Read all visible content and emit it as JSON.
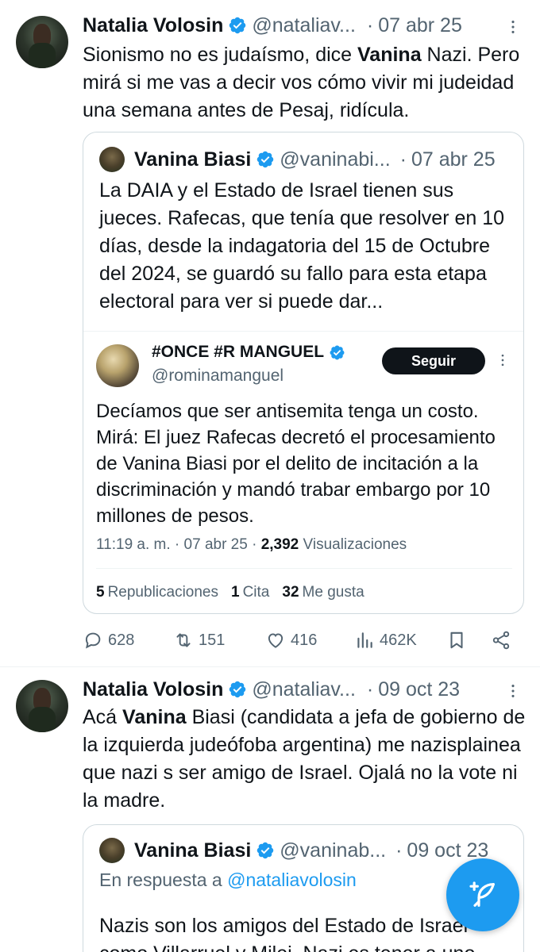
{
  "tweet1": {
    "name": "Natalia Volosin",
    "handle": "@nataliav...",
    "date": "07 abr 25",
    "text_a": "Sionismo no es judaísmo, dice ",
    "text_bold": "Vanina",
    "text_b": " Nazi. Pero mirá si me vas a decir vos cómo vivir mi judeidad una semana antes de Pesaj, ridícula.",
    "quote": {
      "name": "Vanina Biasi",
      "handle": "@vaninabi...",
      "date": "07 abr 25",
      "text": "La DAIA y el Estado de Israel tienen sus jueces. Rafecas, que tenía que resolver en 10 días, desde la indagatoria del 15 de Octubre del 2024, se guardó su fallo para esta etapa electoral para ver si puede dar...",
      "embed": {
        "name": "#ONCE #R MANGUEL",
        "handle": "@rominamanguel",
        "follow_label": "Seguir",
        "text": "Decíamos que ser antisemita tenga un costo. Mirá: El juez Rafecas decretó el procesamiento de Vanina Biasi por el delito de incitación a la discriminación y mandó trabar embargo por 10 millones de pesos.",
        "time": "11:19 a. m. · 07 abr 25 · ",
        "views_count": "2,392",
        "views_label": " Visualizaciones",
        "reposts_count": "5",
        "reposts_label": "Republicaciones",
        "quotes_count": "1",
        "quotes_label": "Cita",
        "likes_count": "32",
        "likes_label": "Me gusta"
      }
    },
    "actions": {
      "replies": "628",
      "retweets": "151",
      "likes": "416",
      "views": "462K"
    }
  },
  "tweet2": {
    "name": "Natalia Volosin",
    "handle": "@nataliav...",
    "date": "09 oct 23",
    "text_a": "Acá ",
    "text_bold": "Vanina",
    "text_b": " Biasi (candidata a jefa de gobierno de la izquierda judeófoba argentina) me nazisplainea que nazi s ser amigo de Israel. Ojalá no la vote ni la madre.",
    "quote": {
      "name": "Vanina Biasi",
      "handle": "@vaninab...",
      "date": "09 oct 23",
      "reply_prefix": "En respuesta a ",
      "reply_to": "@nataliavolosin",
      "text": "Nazis son los amigos del Estado de Israel como Villarruel y Milei. Nazi es tener a uno"
    }
  },
  "icons": {
    "verified": "verified-badge-icon",
    "more": "more-dots-icon",
    "reply": "reply-icon",
    "retweet": "retweet-icon",
    "like": "heart-icon",
    "views": "views-bar-icon",
    "bookmark": "bookmark-icon",
    "share": "share-icon",
    "compose": "compose-feather-icon"
  },
  "colors": {
    "accent": "#1d9bf0",
    "text": "#0f1419",
    "secondary": "#536471",
    "border": "#cfd9de"
  }
}
